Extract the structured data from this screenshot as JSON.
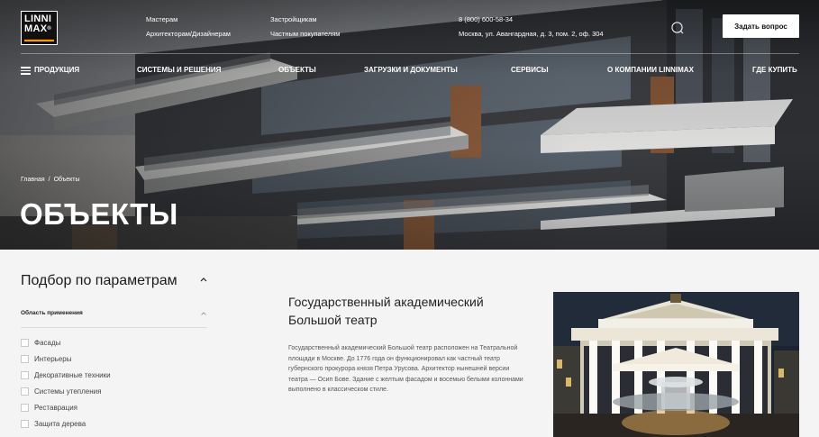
{
  "logo": {
    "line1": "LINNI",
    "line2": "MAX",
    "mark": "®"
  },
  "topbar": {
    "links_col1": [
      "Мастерам",
      "Архитекторам/Дизайнерам"
    ],
    "links_col2": [
      "Застройщикам",
      "Частным покупателям"
    ],
    "phone": "8 (800) 600-58-34",
    "address": "Москва, ул. Авангардная, д. 3, пом. 2, оф. 304",
    "search_icon": "search-icon",
    "ask_button": "Задать вопрос"
  },
  "nav": {
    "items": [
      "ПРОДУКЦИЯ",
      "СИСТЕМЫ И РЕШЕНИЯ",
      "ОБЪЕКТЫ",
      "ЗАГРУЗКИ И ДОКУМЕНТЫ",
      "СЕРВИСЫ",
      "О КОМПАНИИ LINNIMAX",
      "ГДЕ КУПИТЬ"
    ]
  },
  "breadcrumb": {
    "home": "Главная",
    "separator": "/",
    "current": "Объекты"
  },
  "page_title": "ОБЪЕКТЫ",
  "filter": {
    "title": "Подбор по параметрам",
    "area_label": "Область применения",
    "options": [
      "Фасады",
      "Интерьеры",
      "Декоративные техники",
      "Системы утепления",
      "Реставрация",
      "Защита дерева"
    ]
  },
  "object": {
    "title": "Государственный академический Большой театр",
    "description": "Государственный академический Большой театр расположен на Театральной площади в Москве. До 1776 года он функционировал как частный театр губернского прокурора князя Петра Урусова. Архитектор нынешней версии театра — Осип Бове. Здание с желтым фасадом и восемью белыми колоннами выполнено в классическом стиле."
  },
  "colors": {
    "accent": "#111111",
    "background": "#f4f4f4",
    "hero_text": "#ffffff"
  }
}
